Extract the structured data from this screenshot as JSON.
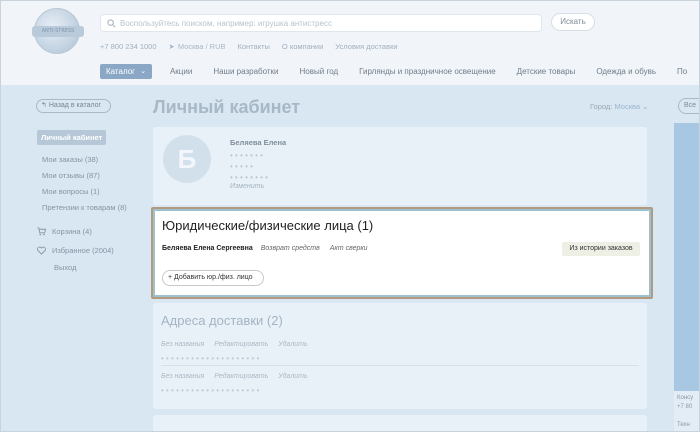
{
  "header": {
    "logo_text": "ANTI-STRESS",
    "search_placeholder": "Воспользуйтесь поиском, например: игрушка антистресс",
    "search_button": "Искать",
    "phone": "+7 800 234 1000",
    "location": "Москва / RUB",
    "links": [
      "Контакты",
      "О компании",
      "Условия доставки"
    ],
    "catalog_label": "Каталог",
    "nav_items": [
      "Акции",
      "Наши разработки",
      "Новый год",
      "Гирлянды и праздничное освещение",
      "Детские товары",
      "Одежда и обувь",
      "По"
    ]
  },
  "page": {
    "back_label": "Назад в каталог",
    "title": "Личный кабинет",
    "city_label": "Город:",
    "city_value": "Москва",
    "right_chip": "Все"
  },
  "sidebar": {
    "active": "Личный кабинет",
    "items": [
      "Мои заказы (38)",
      "Мои отзывы (87)",
      "Мои вопросы (1)",
      "Претензии к товарам (8)"
    ],
    "cart": "Корзина (4)",
    "favorites": "Избранное (2004)",
    "logout": "Выход"
  },
  "profile": {
    "avatar_letter": "Б",
    "name": "Беляева Елена",
    "masked_line1": "• • • • • • •",
    "masked_line2": "• • • • •",
    "masked_line3": "• • • • • • • •",
    "edit": "Изменить"
  },
  "legal": {
    "title": "Юридические/физические лица (1)",
    "person": "Беляева Елена Сергеевна",
    "link_return": "Возврат средств",
    "link_act": "Акт сверки",
    "history_button": "Из истории заказов",
    "add_button": "+ Добавить юр./физ. лицо"
  },
  "addresses": {
    "title": "Адреса доставки (2)",
    "rows": [
      {
        "name": "Без названия",
        "edit": "Редактировать",
        "delete": "Удалить"
      },
      {
        "name": "Без названия",
        "edit": "Редактировать",
        "delete": "Удалить"
      }
    ],
    "masked": "• • • • • • • • • • • • • • • • • • • •"
  },
  "right_panel": {
    "text1": "Консу",
    "text2": "+7 80",
    "text3": "Техн"
  }
}
